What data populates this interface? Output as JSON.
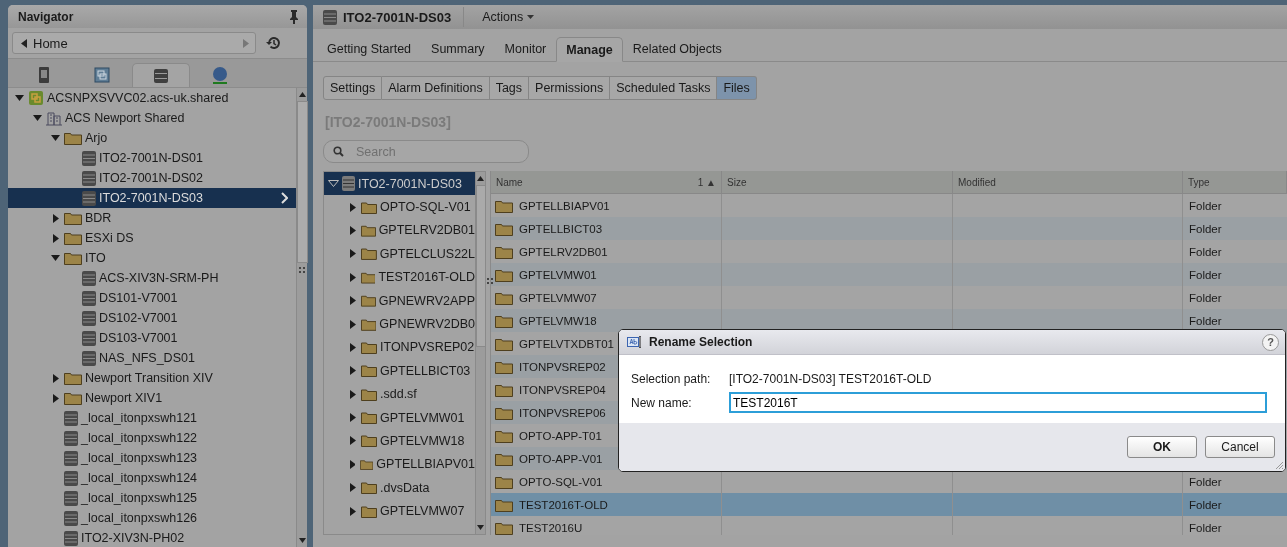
{
  "navigator": {
    "title": "Navigator",
    "home": "Home",
    "tabs": [
      {
        "kind": "hosts",
        "selected": false
      },
      {
        "kind": "vms",
        "selected": false
      },
      {
        "kind": "storage",
        "selected": true
      },
      {
        "kind": "network",
        "selected": false
      }
    ],
    "tree": [
      {
        "label": "ACSNPXSVVC02.acs-uk.shared",
        "kind": "vcenter",
        "expanded": true,
        "selected": false,
        "children": [
          {
            "label": "ACS Newport Shared",
            "kind": "datacenter",
            "expanded": true,
            "selected": false,
            "children": [
              {
                "label": "Arjo",
                "kind": "folder",
                "expanded": true,
                "selected": false,
                "children": [
                  {
                    "label": "ITO2-7001N-DS01",
                    "kind": "datastore",
                    "selected": false
                  },
                  {
                    "label": "ITO2-7001N-DS02",
                    "kind": "datastore",
                    "selected": false
                  },
                  {
                    "label": "ITO2-7001N-DS03",
                    "kind": "datastore",
                    "selected": true
                  }
                ]
              },
              {
                "label": "BDR",
                "kind": "folder",
                "expanded": false,
                "selected": false
              },
              {
                "label": "ESXi DS",
                "kind": "folder",
                "expanded": false,
                "selected": false
              },
              {
                "label": "ITO",
                "kind": "folder",
                "expanded": true,
                "selected": false,
                "children": [
                  {
                    "label": "ACS-XIV3N-SRM-PH",
                    "kind": "datastore",
                    "selected": false
                  },
                  {
                    "label": "DS101-V7001",
                    "kind": "datastore",
                    "selected": false
                  },
                  {
                    "label": "DS102-V7001",
                    "kind": "datastore",
                    "selected": false
                  },
                  {
                    "label": "DS103-V7001",
                    "kind": "datastore",
                    "selected": false
                  },
                  {
                    "label": "NAS_NFS_DS01",
                    "kind": "datastore",
                    "selected": false
                  }
                ]
              },
              {
                "label": "Newport Transition XIV",
                "kind": "folder",
                "expanded": false,
                "selected": false
              },
              {
                "label": "Newport XIV1",
                "kind": "folder",
                "expanded": false,
                "selected": false
              },
              {
                "label": "_local_itonpxswh121",
                "kind": "datastore",
                "selected": false
              },
              {
                "label": "_local_itonpxswh122",
                "kind": "datastore",
                "selected": false
              },
              {
                "label": "_local_itonpxswh123",
                "kind": "datastore",
                "selected": false
              },
              {
                "label": "_local_itonpxswh124",
                "kind": "datastore",
                "selected": false
              },
              {
                "label": "_local_itonpxswh125",
                "kind": "datastore",
                "selected": false
              },
              {
                "label": "_local_itonpxswh126",
                "kind": "datastore",
                "selected": false
              },
              {
                "label": "ITO2-XIV3N-PH02",
                "kind": "datastore",
                "selected": false
              }
            ]
          }
        ]
      }
    ]
  },
  "object": {
    "title": "ITO2-7001N-DS03",
    "actions": "Actions"
  },
  "tabs": [
    {
      "label": "Getting Started",
      "selected": false
    },
    {
      "label": "Summary",
      "selected": false
    },
    {
      "label": "Monitor",
      "selected": false
    },
    {
      "label": "Manage",
      "selected": true
    },
    {
      "label": "Related Objects",
      "selected": false
    }
  ],
  "subtabs": [
    {
      "label": "Settings",
      "selected": false
    },
    {
      "label": "Alarm Definitions",
      "selected": false
    },
    {
      "label": "Tags",
      "selected": false
    },
    {
      "label": "Permissions",
      "selected": false
    },
    {
      "label": "Scheduled Tasks",
      "selected": false
    },
    {
      "label": "Files",
      "selected": true
    }
  ],
  "files": {
    "heading": "[ITO2-7001N-DS03]",
    "search": {
      "placeholder": "Search"
    },
    "folder_tree": [
      {
        "label": "ITO2-7001N-DS03",
        "kind": "datastore",
        "expanded": true,
        "selected": true,
        "children": [
          {
            "label": "OPTO-SQL-V01",
            "kind": "folder",
            "expanded": false,
            "selected": false
          },
          {
            "label": "GPTELRV2DB01",
            "kind": "folder",
            "expanded": false,
            "selected": false
          },
          {
            "label": "GPTELCLUS22L",
            "kind": "folder",
            "expanded": false,
            "selected": false
          },
          {
            "label": "TEST2016T-OLD",
            "kind": "folder",
            "expanded": false,
            "selected": false
          },
          {
            "label": "GPNEWRV2APP",
            "kind": "folder",
            "expanded": false,
            "selected": false
          },
          {
            "label": "GPNEWRV2DB0",
            "kind": "folder",
            "expanded": false,
            "selected": false
          },
          {
            "label": "ITONPVSREP02",
            "kind": "folder",
            "expanded": false,
            "selected": false
          },
          {
            "label": "GPTELLBICT03",
            "kind": "folder",
            "expanded": false,
            "selected": false
          },
          {
            "label": ".sdd.sf",
            "kind": "folder",
            "expanded": false,
            "selected": false
          },
          {
            "label": "GPTELVMW01",
            "kind": "folder",
            "expanded": false,
            "selected": false
          },
          {
            "label": "GPTELVMW18",
            "kind": "folder",
            "expanded": false,
            "selected": false
          },
          {
            "label": "GPTELLBIAPV01",
            "kind": "folder",
            "expanded": false,
            "selected": false
          },
          {
            "label": ".dvsData",
            "kind": "folder",
            "expanded": false,
            "selected": false
          },
          {
            "label": "GPTELVMW07",
            "kind": "folder",
            "expanded": false,
            "selected": false
          }
        ]
      }
    ],
    "table": {
      "columns": [
        "Name",
        "Size",
        "Modified",
        "Type"
      ],
      "sort": "1 ▲",
      "rows": [
        {
          "name": "GPTELLBIAPV01",
          "type": "Folder",
          "selected": false
        },
        {
          "name": "GPTELLBICT03",
          "type": "Folder",
          "selected": false
        },
        {
          "name": "GPTELRV2DB01",
          "type": "Folder",
          "selected": false
        },
        {
          "name": "GPTELVMW01",
          "type": "Folder",
          "selected": false
        },
        {
          "name": "GPTELVMW07",
          "type": "Folder",
          "selected": false
        },
        {
          "name": "GPTELVMW18",
          "type": "Folder",
          "selected": false
        },
        {
          "name": "GPTELVTXDBT01",
          "selected": false
        },
        {
          "name": "ITONPVSREP02",
          "selected": false
        },
        {
          "name": "ITONPVSREP04",
          "selected": false
        },
        {
          "name": "ITONPVSREP06",
          "selected": false
        },
        {
          "name": "OPTO-APP-T01",
          "selected": false
        },
        {
          "name": "OPTO-APP-V01",
          "selected": false
        },
        {
          "name": "OPTO-SQL-V01",
          "type": "Folder",
          "selected": false
        },
        {
          "name": "TEST2016T-OLD",
          "type": "Folder",
          "selected": true
        },
        {
          "name": "TEST2016U",
          "type": "Folder",
          "selected": false
        }
      ]
    }
  },
  "dialog": {
    "title": "Rename Selection",
    "help": "?",
    "path_label": "Selection path:",
    "path": "[ITO2-7001N-DS03] TEST2016T-OLD",
    "name_label": "New name:",
    "name_value": "TEST2016T",
    "buttons": [
      "OK",
      "Cancel"
    ]
  }
}
